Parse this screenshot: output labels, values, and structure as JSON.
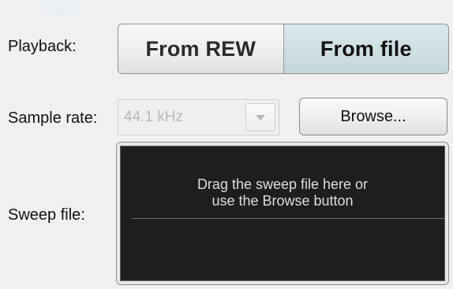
{
  "playback": {
    "label": "Playback:",
    "options": [
      "From REW",
      "From file"
    ],
    "selected": "From file"
  },
  "sample_rate": {
    "label": "Sample rate:",
    "value": "44.1 kHz",
    "enabled": false
  },
  "browse": {
    "label": "Browse..."
  },
  "sweep_file": {
    "label": "Sweep file:",
    "drop_text_line1": "Drag the sweep file here or",
    "drop_text_line2": "use the Browse button"
  },
  "colors": {
    "selected_segment": "#cfe0e5",
    "drop_zone_background": "#1e1e1e"
  },
  "icons": {
    "dropdown": "chevron-down-icon"
  }
}
